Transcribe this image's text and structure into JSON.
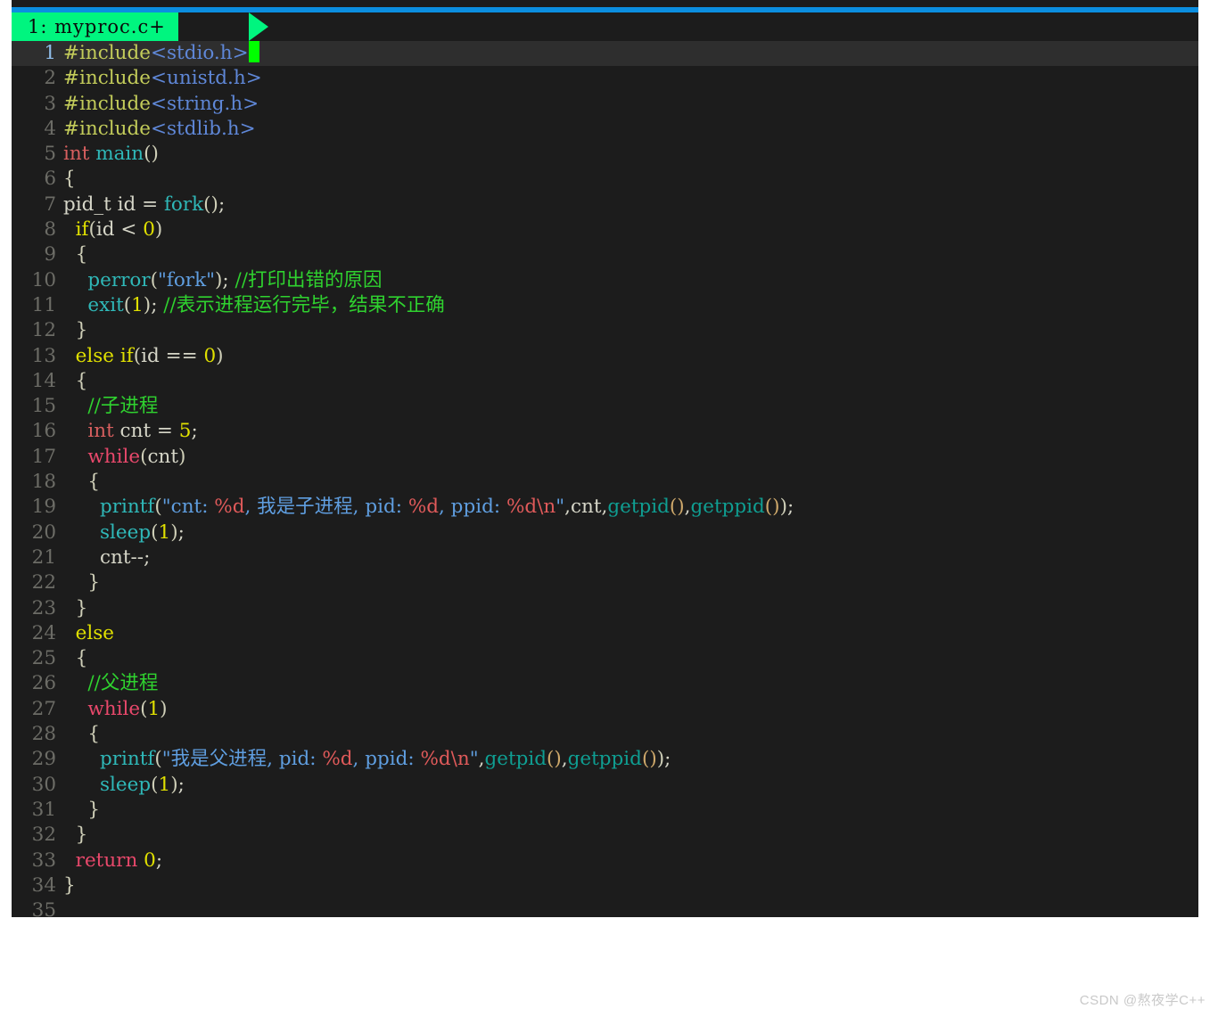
{
  "window": {
    "accent_color": "#0b8ee0",
    "background_color": "#1c1c1c",
    "current_line_color": "#2e2e2e"
  },
  "tabline": {
    "tab_label": "1: myproc.c+",
    "tab_color": "#00f57f",
    "tab_text_color": "#0a0a0a"
  },
  "cursor": {
    "color": "#00ff00",
    "line": 1,
    "column": 19
  },
  "editor": {
    "filename": "myproc.c",
    "modified": true,
    "total_lines": 35,
    "line_numbers": [
      "1",
      "2",
      "3",
      "4",
      "5",
      "6",
      "7",
      "8",
      "9",
      "10",
      "11",
      "12",
      "13",
      "14",
      "15",
      "16",
      "17",
      "18",
      "19",
      "20",
      "21",
      "22",
      "23",
      "24",
      "25",
      "26",
      "27",
      "28",
      "29",
      "30",
      "31",
      "32",
      "33",
      "34",
      "35"
    ],
    "lines": [
      "#include<stdio.h>",
      "#include<unistd.h>",
      "#include<string.h>",
      "#include<stdlib.h>",
      "int main()",
      "{",
      "  pid_t id = fork();",
      "  if(id < 0)",
      "  {",
      "    perror(\"fork\"); //打印出错的原因",
      "    exit(1); //表示进程运行完毕，结果不正确",
      "  }",
      "  else if(id == 0)",
      "  {",
      "    //子进程",
      "    int cnt = 5;",
      "    while(cnt)",
      "    {",
      "      printf(\"cnt: %d, 我是子进程, pid: %d, ppid: %d\\n\",cnt,getpid(),getppid());",
      "      sleep(1);",
      "      cnt--;",
      "    }",
      "  }",
      "  else",
      "  {",
      "    //父进程",
      "    while(1)",
      "    {",
      "      printf(\"我是父进程, pid: %d, ppid: %d\\n\",getpid(),getppid());",
      "      sleep(1);",
      "    }",
      "  }",
      "  return 0;",
      "}",
      ""
    ]
  },
  "tokens": {
    "l1": {
      "pre": "#include",
      "inc": "<stdio.h>"
    },
    "l2": {
      "pre": "#include",
      "inc": "<unistd.h>"
    },
    "l3": {
      "pre": "#include",
      "inc": "<string.h>"
    },
    "l4": {
      "pre": "#include",
      "inc": "<stdlib.h>"
    },
    "l5": {
      "type": "int",
      "fn": "main",
      "paren": "()"
    },
    "l6": {
      "brace": "{"
    },
    "l7": {
      "ident": "pid_t id = ",
      "call": "fork",
      "paren": "()",
      "punc": ";"
    },
    "l8": {
      "cond": "if",
      "paren1": "(",
      "ident": "id < ",
      "num": "0",
      "paren2": ")"
    },
    "l9": {
      "brace": "{"
    },
    "l10": {
      "call": "perror",
      "paren1": "(",
      "str": "\"fork\"",
      "paren2": ")",
      "punc": ";",
      "comment": " //打印出错的原因"
    },
    "l11": {
      "call": "exit",
      "paren1": "(",
      "num": "1",
      "paren2": ")",
      "punc": ";",
      "comment": " //表示进程运行完毕，结果不正确"
    },
    "l12": {
      "brace": "}"
    },
    "l13": {
      "cond1": "else if",
      "paren1": "(",
      "ident": "id == ",
      "num": "0",
      "paren2": ")"
    },
    "l14": {
      "brace": "{"
    },
    "l15": {
      "comment": "//子进程"
    },
    "l16": {
      "type": "int",
      "ident": " cnt = ",
      "num": "5",
      "punc": ";"
    },
    "l17": {
      "loop": "while",
      "paren1": "(",
      "ident": "cnt",
      "paren2": ")"
    },
    "l18": {
      "brace": "{"
    },
    "l19": {
      "call": "printf",
      "paren1": "(",
      "str_a": "\"cnt: ",
      "fmt_a": "%d",
      "str_b": ", 我是子进程, pid: ",
      "fmt_b": "%d",
      "str_c": ", ppid: ",
      "fmt_c": "%d\\n",
      "str_d": "\"",
      "args": ",cnt,",
      "call2_a": "getpid",
      "p_a": "()",
      "comma": ",",
      "call2_b": "getppid",
      "p_b": "()",
      "paren2": ")",
      "punc": ";"
    },
    "l20": {
      "call": "sleep",
      "paren1": "(",
      "num": "1",
      "paren2": ")",
      "punc": ";"
    },
    "l21": {
      "ident": "cnt--",
      "punc": ";"
    },
    "l22": {
      "brace": "}"
    },
    "l23": {
      "brace": "}"
    },
    "l24": {
      "cond": "else"
    },
    "l25": {
      "brace": "{"
    },
    "l26": {
      "comment": "//父进程"
    },
    "l27": {
      "loop": "while",
      "paren1": "(",
      "num": "1",
      "paren2": ")"
    },
    "l28": {
      "brace": "{"
    },
    "l29": {
      "call": "printf",
      "paren1": "(",
      "str_a": "\"我是父进程, pid: ",
      "fmt_a": "%d",
      "str_b": ", ppid: ",
      "fmt_b": "%d\\n",
      "str_c": "\"",
      "args": ",",
      "call2_a": "getpid",
      "p_a": "()",
      "comma": ",",
      "call2_b": "getppid",
      "p_b": "()",
      "paren2": ")",
      "punc": ";"
    },
    "l30": {
      "call": "sleep",
      "paren1": "(",
      "num": "1",
      "paren2": ")",
      "punc": ";"
    },
    "l31": {
      "brace": "}"
    },
    "l32": {
      "brace": "}"
    },
    "l33": {
      "loop": "return",
      "space": " ",
      "num": "0",
      "punc": ";"
    },
    "l34": {
      "brace": "}"
    },
    "l35": {
      "blank": ""
    }
  },
  "watermark": {
    "text": "CSDN @熬夜学C++"
  }
}
